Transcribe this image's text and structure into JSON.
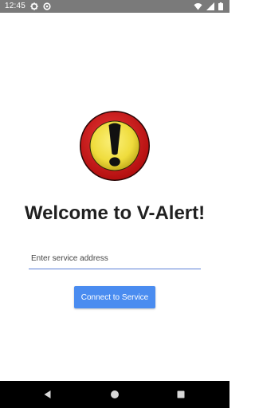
{
  "status_bar": {
    "time": "12:45",
    "left_icons": [
      "gear-icon",
      "data-saver-icon"
    ],
    "right_icons": [
      "wifi-icon",
      "signal-icon",
      "battery-icon"
    ]
  },
  "logo": {
    "icon": "exclamation-warning-icon"
  },
  "welcome": {
    "title": "Welcome to V-Alert!"
  },
  "address": {
    "placeholder": "Enter service address",
    "value": ""
  },
  "connect_button": {
    "label": "Connect to Service"
  },
  "nav_bar": {
    "buttons": [
      "back-icon",
      "home-icon",
      "recents-icon"
    ]
  },
  "colors": {
    "status_bar": "#7a7a7a",
    "accent": "#4a8cf0",
    "underline": "#5b7fd6",
    "logo_red": "#d81e1e",
    "logo_yellow": "#f2e14a"
  }
}
